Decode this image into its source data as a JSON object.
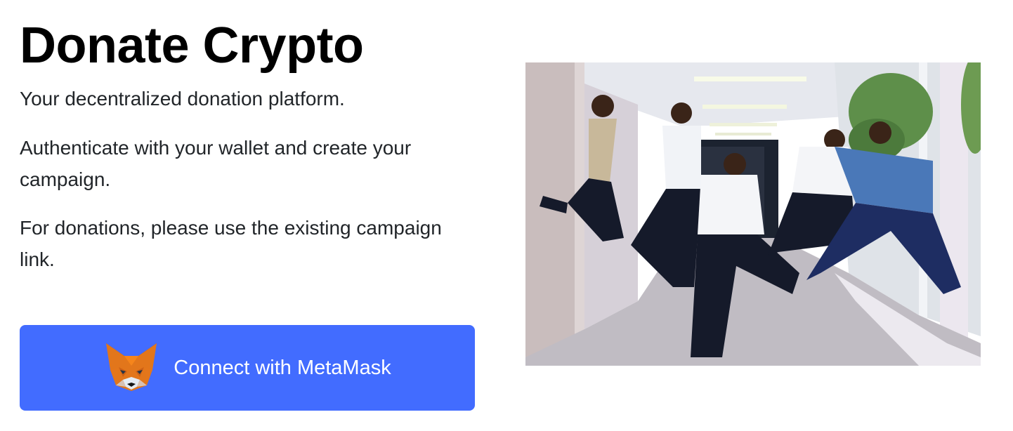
{
  "hero": {
    "title": "Donate Crypto",
    "tagline": "Your decentralized donation platform.",
    "instructions": "Authenticate with your wallet and create your campaign.",
    "donation_note": "For donations, please use the existing campaign link."
  },
  "connect_button": {
    "label": "Connect with MetaMask",
    "icon": "metamask-fox-icon",
    "color": "#426cff"
  },
  "photo": {
    "subject": "people-jumping-in-corridor"
  }
}
